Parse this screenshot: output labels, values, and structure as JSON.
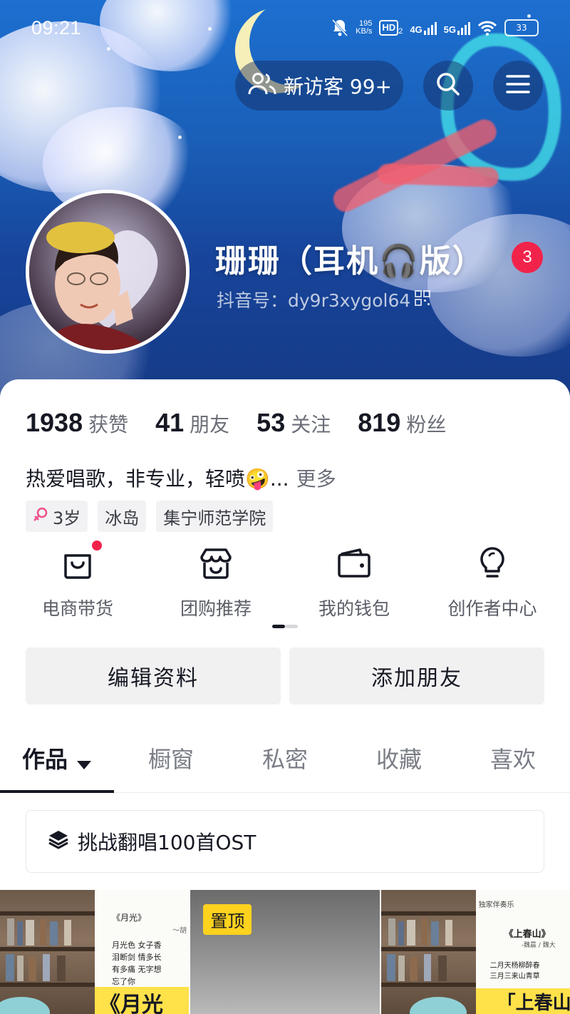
{
  "status_bar": {
    "time": "09:21",
    "net_speed_value": "195",
    "net_speed_unit": "KB/s",
    "hd": "HD",
    "hd_sub": "2",
    "sig1": "4G",
    "sig2": "5G",
    "battery": "33"
  },
  "header": {
    "visitor_label": "新访客 99+",
    "display_name": "珊珊（耳机🎧版）",
    "notification_count": "3",
    "douyin_id": "抖音号：dy9r3xygol64"
  },
  "stats": [
    {
      "num": "1938",
      "label": "获赞"
    },
    {
      "num": "41",
      "label": "朋友"
    },
    {
      "num": "53",
      "label": "关注"
    },
    {
      "num": "819",
      "label": "粉丝"
    }
  ],
  "bio": {
    "text": "热爱唱歌，非专业，轻喷🤪...",
    "more": "更多"
  },
  "tags": [
    {
      "icon": "female-icon",
      "label": "3岁"
    },
    {
      "label": "冰岛"
    },
    {
      "label": "集宁师范学院"
    }
  ],
  "services": [
    {
      "icon": "shopping-bag-icon",
      "label": "电商带货",
      "has_dot": true
    },
    {
      "icon": "store-icon",
      "label": "团购推荐"
    },
    {
      "icon": "wallet-icon",
      "label": "我的钱包"
    },
    {
      "icon": "lightbulb-icon",
      "label": "创作者中心"
    }
  ],
  "actions": {
    "edit_profile": "编辑资料",
    "add_friend": "添加朋友"
  },
  "tabs": [
    {
      "label": "作品",
      "active": true
    },
    {
      "label": "橱窗"
    },
    {
      "label": "私密"
    },
    {
      "label": "收藏"
    },
    {
      "label": "喜欢"
    }
  ],
  "playlist": {
    "label": "挑战翻唱100首OST"
  },
  "thumbs": {
    "doc1_title": "《月光》",
    "doc1_sub": "～胡",
    "doc1_lines": [
      "月光色 女子香",
      "泪断剑 情多长",
      "有多痛 无字想",
      "忘了你"
    ],
    "doc1_big": "《月光",
    "pinned": "置顶",
    "doc2_header": "独家伴奏乐",
    "doc2_title": "《上春山》",
    "doc2_sub": "-魏晨 / 魏大",
    "doc2_lines": [
      "二月天杨柳醉春",
      "三月三来山青草"
    ],
    "doc2_big": "「上春山"
  },
  "colors": {
    "accent_red": "#f2234b",
    "pin_yellow": "#ffd21e",
    "banner_blue": "#1a5fb8"
  }
}
